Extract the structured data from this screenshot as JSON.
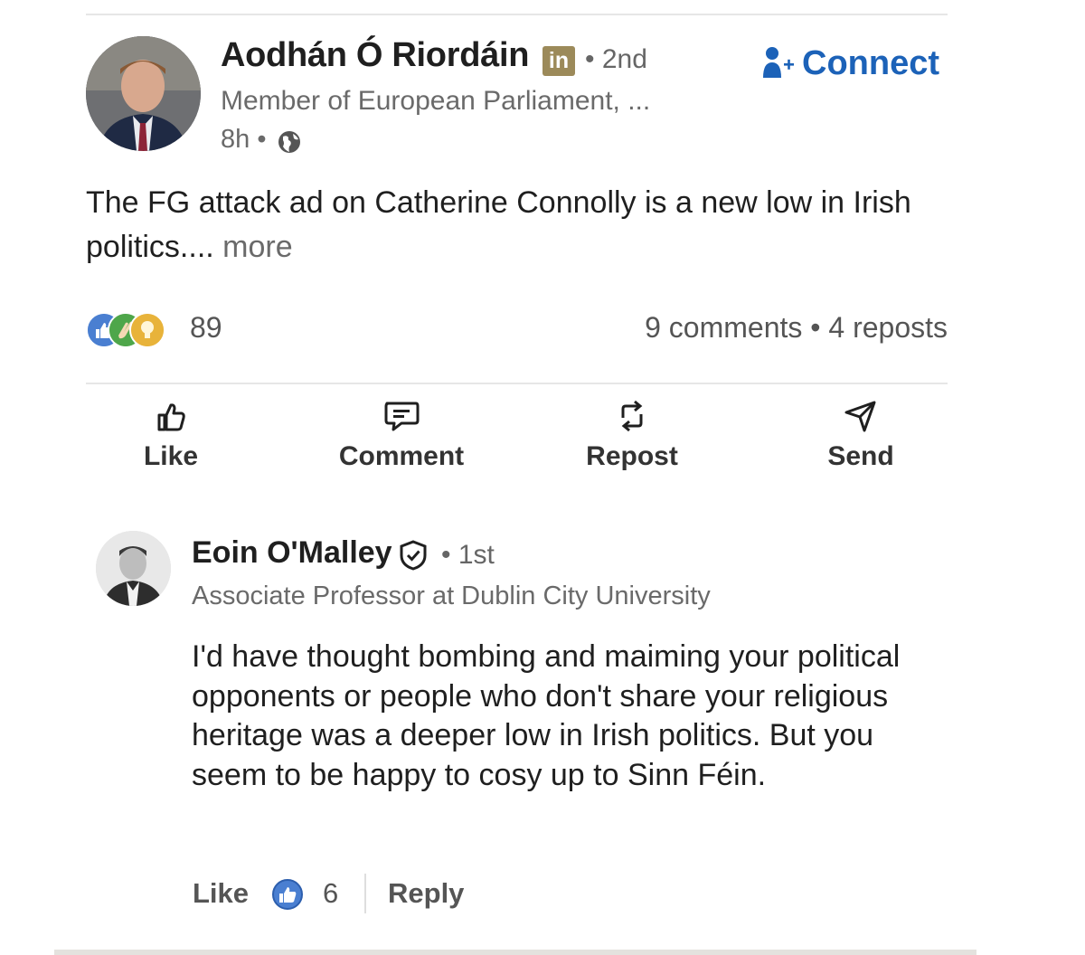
{
  "post": {
    "author": {
      "name": "Aodhán Ó Riordáin",
      "badge": "in",
      "degree": "• 2nd",
      "headline": "Member of European Parliament, ...",
      "time": "8h •",
      "avatar_icon": "person-photo"
    },
    "connect_label": "Connect",
    "text": "The FG attack ad on Catherine Connolly is a new low in Irish politics....",
    "more_label": "more",
    "reactions": {
      "icons": [
        "like-icon",
        "celebrate-icon",
        "insightful-icon"
      ],
      "count": "89"
    },
    "stats": "9 comments • 4 reposts",
    "actions": {
      "like": "Like",
      "comment": "Comment",
      "repost": "Repost",
      "send": "Send"
    }
  },
  "comment": {
    "author": {
      "name": "Eoin O'Malley",
      "degree": "• 1st",
      "headline": "Associate Professor at Dublin City University",
      "avatar_icon": "person-photo"
    },
    "text": "I'd have thought bombing and maiming your political opponents or people who don't share your religious heritage was a deeper low in Irish politics. But you seem to be happy to cosy up to Sinn Féin.",
    "like_label": "Like",
    "like_count": "6",
    "reply_label": "Reply"
  },
  "colors": {
    "accent": "#1c62b8",
    "text_primary": "#1f1f1f",
    "text_secondary": "#6a6a6a",
    "divider": "#e6e6e6"
  }
}
